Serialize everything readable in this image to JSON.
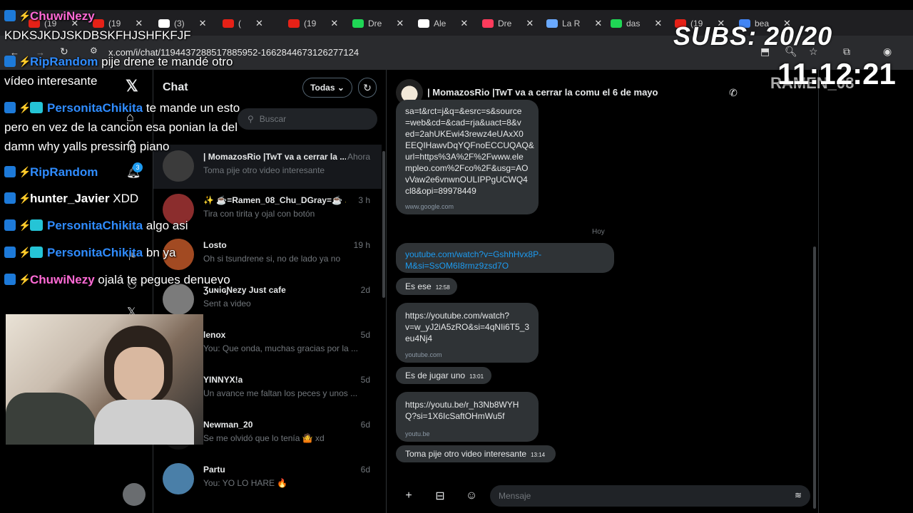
{
  "browser": {
    "tabs": [
      {
        "label": "(19",
        "color": "#e62117"
      },
      {
        "label": "(19",
        "color": "#e62117"
      },
      {
        "label": "(3)",
        "color": "#ffffff"
      },
      {
        "label": "(",
        "color": "#e62117"
      },
      {
        "label": "(19",
        "color": "#e62117"
      },
      {
        "label": "Dre",
        "color": "#1fd655"
      },
      {
        "label": "Ale",
        "color": "#ffffff"
      },
      {
        "label": "Dre",
        "color": "#ff3b5c"
      },
      {
        "label": "La R",
        "color": "#6aa9ff"
      },
      {
        "label": "das",
        "color": "#1fd655"
      },
      {
        "label": "(19",
        "color": "#e62117"
      },
      {
        "label": "bea",
        "color": "#4285f4"
      }
    ],
    "url": "x.com/i/chat/1194437288517885952-1662844673126277124"
  },
  "sidebar": {
    "chat_title": "Chat",
    "filter_label": "Todas",
    "search_placeholder": "Buscar"
  },
  "conversations": [
    {
      "name": "| MomazosRio |TwT va a cerrar la ...",
      "time": "Ahora",
      "preview": "Toma pije otro video interesante",
      "avatar_color": "#3b3b3b"
    },
    {
      "name": "✨ ☕=Ramen_08_Chu_DGray=☕ ✨",
      "time": "3 h",
      "preview": "Tira con tirita y ojal con botón",
      "avatar_color": "#8b2d2d"
    },
    {
      "name": "Losto",
      "time": "19 h",
      "preview": "Oh si tsundrene si, no de lado ya no",
      "avatar_color": "#a24a22"
    },
    {
      "name": "ƷuɴiɢƝezy Just cafe",
      "time": "2d",
      "preview": "Sent a video",
      "avatar_color": "#7b7b7b"
    },
    {
      "name": "lenox",
      "time": "5d",
      "preview": "You: Que onda, muchas gracias por la ...",
      "avatar_color": "#222222"
    },
    {
      "name": "YINNYX!a",
      "time": "5d",
      "preview": "Un avance me faltan los peces y unos ...",
      "avatar_color": "#1a1a1a"
    },
    {
      "name": "Newman_20",
      "time": "6d",
      "preview": "Se me olvidó que lo tenía 🤷 xd",
      "avatar_color": "#101010"
    },
    {
      "name": "Partu",
      "time": "6d",
      "preview": "You: YO LO HARE 🔥",
      "avatar_color": "#4a7fa8"
    }
  ],
  "chat": {
    "header_name": "| MomazosRio |TwT va a cerrar la comu el 6 de mayo",
    "day_separator": "Hoy",
    "messages": [
      {
        "text": "sa=t&rct=j&q=&esrc=s&source\n=web&cd=&cad=rja&uact=8&v\ned=2ahUKEwi43rewz4eUAxX0\nEEQIHawvDqYQFnoECCUQAQ&\nurl=https%3A%2F%2Fwww.ele\nmpleo.com%2Fco%2F&usg=AO\nvVaw2e6vnwnOULIPPgUCWQ4\ncl8&opi=89978449",
        "domain": "www.google.com"
      },
      {
        "text": "youtube.com/watch?v=GshhHvx8P-\nM&si=SsOM6I8rmz9zsd7O",
        "domain": ""
      },
      {
        "text": "Es ese",
        "time": "12:58"
      },
      {
        "text": "https://youtube.com/watch?\nv=w_yJ2iA5zRO&si=4qNIi6T5_3\neu4Nj4",
        "domain": "youtube.com"
      },
      {
        "text": "Es  de jugar uno",
        "time": "13:01"
      },
      {
        "text": "https://youtu.be/r_h3Nb8WYH\nQ?si=1X6IcSaftOHmWu5f",
        "domain": "youtu.be"
      },
      {
        "text": "Toma pije otro video interesante",
        "time": "13:14"
      }
    ],
    "composer_placeholder": "Mensaje"
  },
  "overlay": {
    "lines": [
      {
        "user": "ChuwiNezy",
        "msg": "",
        "user_color": "#ff6ad5"
      },
      {
        "user": "",
        "msg": "KDKSJKDJSKDBSKFHJSHFKFJF",
        "user_color": "#ffffff"
      },
      {
        "user": "RipRandom",
        "msg": "pije drene te mandé otro",
        "user_color": "#2f8cff"
      },
      {
        "user": "",
        "msg": "vídeo interesante",
        "user_color": "#ffffff"
      },
      {
        "user": "PersonitaChikita",
        "msg": "te mande un esto",
        "user_color": "#2f8cff"
      },
      {
        "user": "",
        "msg": "pero en vez de la cancion esa ponian la del",
        "user_color": "#ffffff"
      },
      {
        "user": "",
        "msg": "damn why yalls pressing piano",
        "user_color": "#ffffff"
      },
      {
        "user": "RipRandom",
        "msg": "",
        "user_color": "#2f8cff"
      },
      {
        "user": "hunter_Javier",
        "msg": "XDD",
        "user_color": "#ffffff"
      },
      {
        "user": "PersonitaChikita",
        "msg": "algo asi",
        "user_color": "#2f8cff"
      },
      {
        "user": "PersonitaChikita",
        "msg": "bn ya",
        "user_color": "#2f8cff"
      },
      {
        "user": "ChuwiNezy",
        "msg": "ojalá te pegues denuevo",
        "user_color": "#ff6ad5"
      }
    ],
    "subs": "SUBS: 20/20",
    "clock": "11:12:21",
    "clock_label": "RAMEN_08"
  }
}
